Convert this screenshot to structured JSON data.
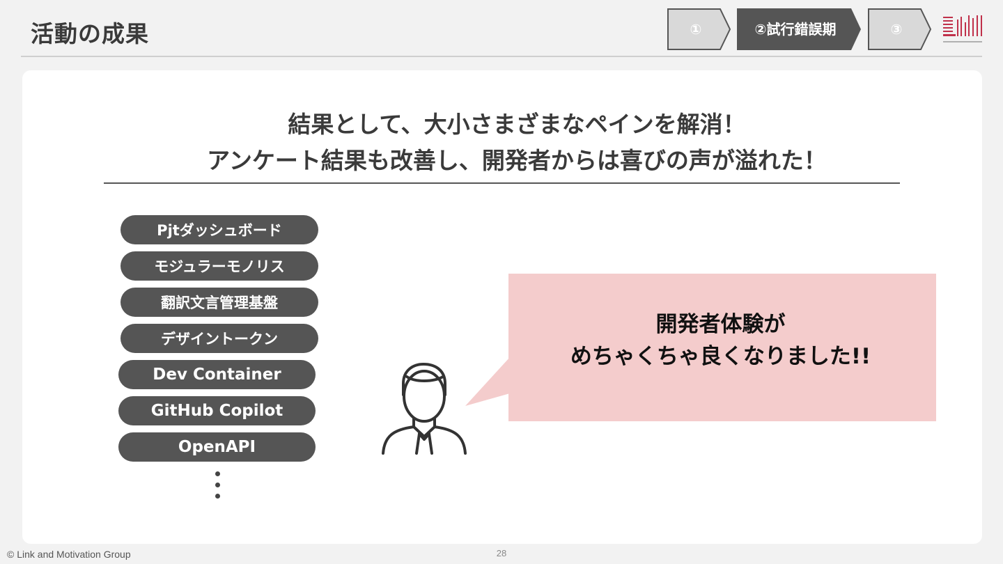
{
  "header": {
    "title": "活動の成果",
    "steps": [
      {
        "label": "①",
        "active": false
      },
      {
        "label": "②試行錯誤期",
        "active": true
      },
      {
        "label": "③",
        "active": false
      }
    ]
  },
  "colors": {
    "step_active": "#555555",
    "step_inactive": "#d9d9d9",
    "pill": "#555555",
    "bubble": "#f4cccc",
    "logo_accent": "#c0304a"
  },
  "main": {
    "headline_line1": "結果として、大小さまざまなペインを解消！",
    "headline_line2": "アンケート結果も改善し、開発者からは喜びの声が溢れた！",
    "initiatives": [
      "Pjtダッシュボード",
      "モジュラーモノリス",
      "翻訳文言管理基盤",
      "デザイントークン",
      "Dev Container",
      "GitHub Copilot",
      "OpenAPI"
    ],
    "more_icon": "vertical-ellipsis-icon",
    "person_icon": "person-icon",
    "bubble_line1": "開発者体験が",
    "bubble_line2": "めちゃくちゃ良くなりました!!"
  },
  "footer": {
    "copyright": "© Link and Motivation Group",
    "page_number": "28"
  }
}
